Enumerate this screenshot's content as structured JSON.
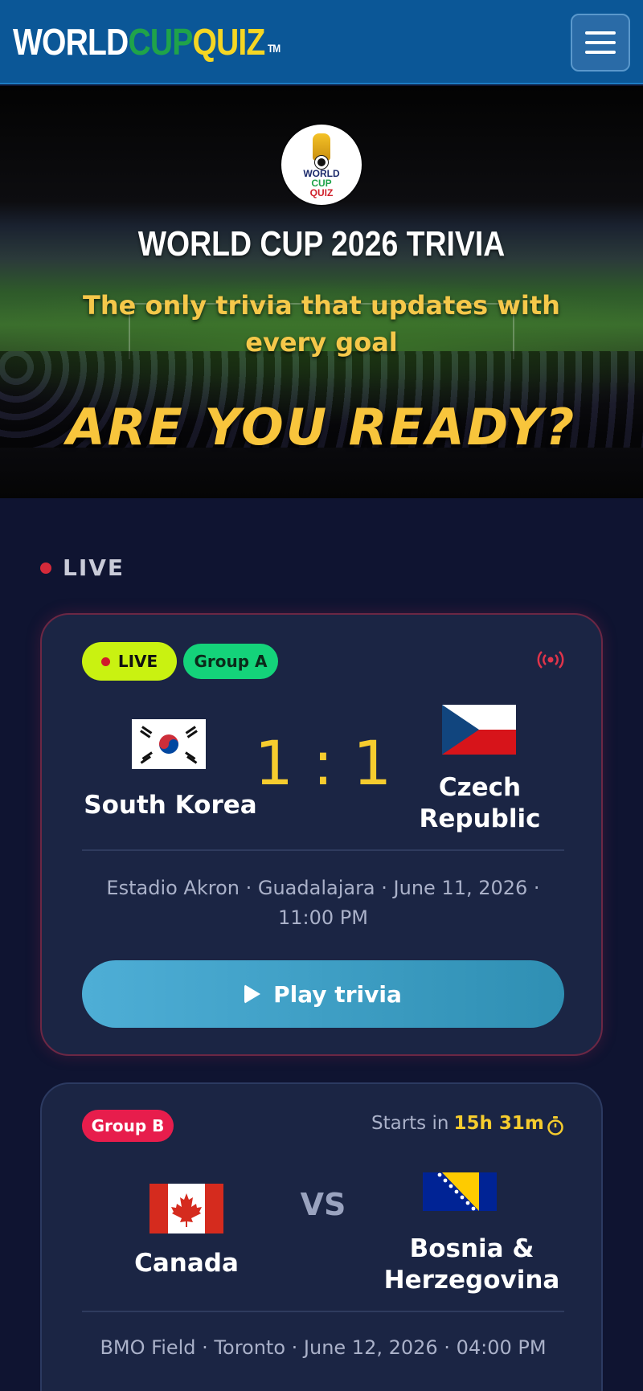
{
  "header": {
    "logo": {
      "world": "WORLD",
      "cup": "CUP",
      "quiz": "QUIZ",
      "tm": "TM"
    },
    "menu_icon": "hamburger-menu-icon"
  },
  "hero": {
    "badge": {
      "line1": "WORLD",
      "line2": "CUP",
      "line3": "QUIZ"
    },
    "title": "WORLD CUP 2026 TRIVIA",
    "subtitle": "The only trivia that updates with every goal",
    "cta": "ARE YOU READY?"
  },
  "live_section": {
    "label": "LIVE"
  },
  "matches": [
    {
      "status": "LIVE",
      "group": "Group A",
      "home": {
        "name": "South Korea",
        "flag": "south-korea-flag"
      },
      "away": {
        "name": "Czech Republic",
        "flag": "czech-republic-flag"
      },
      "score": "1 : 1",
      "venue": "Estadio Akron · Guadalajara · June 11, 2026 · 11:00 PM",
      "action": "Play trivia",
      "icon": "broadcast-icon"
    },
    {
      "group": "Group B",
      "starts_label": "Starts in",
      "starts_time": "15h 31m",
      "home": {
        "name": "Canada",
        "flag": "canada-flag"
      },
      "away": {
        "name": "Bosnia & Herzegovina",
        "flag": "bosnia-herzegovina-flag"
      },
      "vs": "VS",
      "venue": "BMO Field · Toronto · June 12, 2026 · 04:00 PM",
      "icon": "timer-icon"
    }
  ],
  "colors": {
    "header_bg": "#0b5797",
    "page_bg": "#0f1431",
    "card_bg": "#1b2544",
    "accent_yellow": "#f6cc2e",
    "live_green": "#c9f211",
    "group_a": "#14d37a",
    "group_b": "#e71d4c",
    "play_button": "#4eaed6"
  }
}
